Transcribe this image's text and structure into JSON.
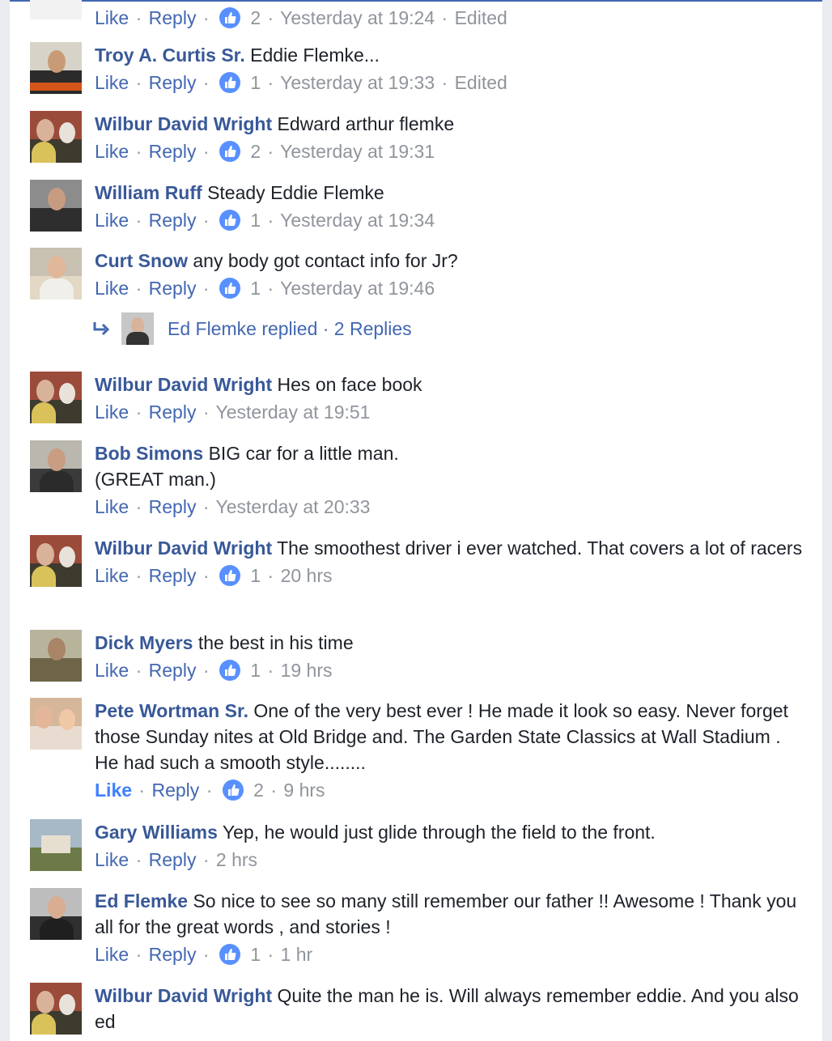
{
  "labels": {
    "like": "Like",
    "reply": "Reply",
    "sep": "·"
  },
  "colors": {
    "author": "#385898",
    "link": "#4267b2",
    "meta": "#90949c",
    "like_badge": "#5890ff"
  },
  "icons": {
    "like_badge": "thumbs-up-icon",
    "reply_arrow": "reply-arrow-icon"
  },
  "comments": [
    {
      "actions": {
        "count": "2",
        "time": "Yesterday at 19:24",
        "edited": "Edited"
      }
    },
    {
      "author": "Troy A. Curtis Sr.",
      "text": "Eddie Flemke...",
      "actions": {
        "count": "1",
        "time": "Yesterday at 19:33",
        "edited": "Edited"
      }
    },
    {
      "author": "Wilbur David Wright",
      "text": "Edward arthur flemke",
      "actions": {
        "count": "2",
        "time": "Yesterday at 19:31"
      }
    },
    {
      "author": "William Ruff",
      "text": "Steady Eddie Flemke",
      "actions": {
        "count": "1",
        "time": "Yesterday at 19:34"
      }
    },
    {
      "author": "Curt Snow",
      "text": "any body got contact info for Jr?",
      "actions": {
        "count": "1",
        "time": "Yesterday at 19:46"
      }
    },
    {
      "author": "Wilbur David Wright",
      "text": "Hes on face book",
      "actions": {
        "time": "Yesterday at 19:51"
      }
    },
    {
      "author": "Bob Simons",
      "text": "BIG car for a little man.",
      "text2": "(GREAT man.)",
      "actions": {
        "time": "Yesterday at 20:33"
      }
    },
    {
      "author": "Wilbur David Wright",
      "text": "The smoothest driver i ever watched. That covers a lot of racers",
      "actions": {
        "count": "1",
        "time": "20 hrs"
      }
    },
    {
      "author": "Dick Myers",
      "text": "the best in his time",
      "actions": {
        "count": "1",
        "time": "19 hrs"
      }
    },
    {
      "author": "Pete Wortman Sr.",
      "text": "One of the very best ever ! He made it look so easy. Never forget those Sunday nites at Old Bridge and. The Garden State Classics at Wall Stadium . He had such a smooth style........",
      "actions": {
        "count": "2",
        "time": "9 hrs"
      }
    },
    {
      "author": "Gary Williams",
      "text": "Yep, he would just glide through the field to the front.",
      "actions": {
        "time": "2 hrs"
      }
    },
    {
      "author": "Ed Flemke",
      "text": "So nice to see so many still remember our father !! Awesome ! Thank you all for the great words , and stories !",
      "actions": {
        "count": "1",
        "time": "1 hr"
      }
    },
    {
      "author": "Wilbur David Wright",
      "text": "Quite the man he is. Will always remember eddie. And you also ed"
    }
  ],
  "replies_link": {
    "text": "Ed Flemke replied · 2 Replies"
  }
}
